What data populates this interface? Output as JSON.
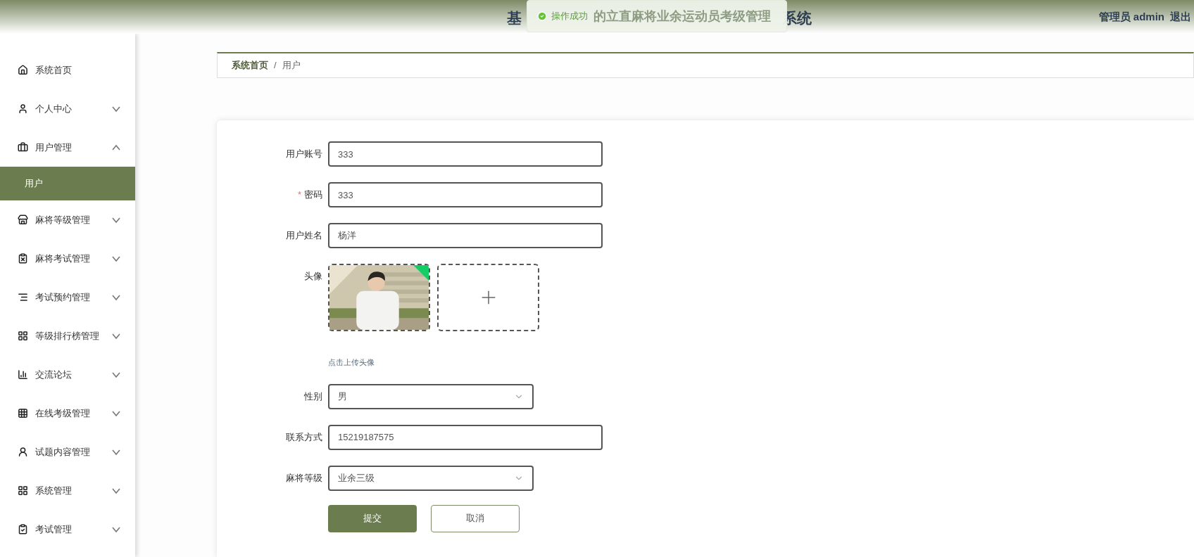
{
  "header": {
    "title_start": "基",
    "title_hidden": "的立直麻将业余运动员考级管理",
    "title_end": "系统",
    "user_label": "管理员 admin",
    "logout": "退出"
  },
  "toast": {
    "message": "操作成功"
  },
  "sidebar": {
    "items": [
      {
        "label": "系统首页",
        "has_submenu": false
      },
      {
        "label": "个人中心",
        "has_submenu": true,
        "expanded": false
      },
      {
        "label": "用户管理",
        "has_submenu": true,
        "expanded": true,
        "children": [
          {
            "label": "用户",
            "selected": true
          }
        ]
      },
      {
        "label": "麻将等级管理",
        "has_submenu": true,
        "expanded": false
      },
      {
        "label": "麻将考试管理",
        "has_submenu": true,
        "expanded": false
      },
      {
        "label": "考试预约管理",
        "has_submenu": true,
        "expanded": false
      },
      {
        "label": "等级排行榜管理",
        "has_submenu": true,
        "expanded": false
      },
      {
        "label": "交流论坛",
        "has_submenu": true,
        "expanded": false
      },
      {
        "label": "在线考级管理",
        "has_submenu": true,
        "expanded": false
      },
      {
        "label": "试题内容管理",
        "has_submenu": true,
        "expanded": false
      },
      {
        "label": "系统管理",
        "has_submenu": true,
        "expanded": false
      },
      {
        "label": "考试管理",
        "has_submenu": true,
        "expanded": false
      }
    ]
  },
  "breadcrumb": {
    "separator": "/",
    "items": [
      {
        "label": "系统首页",
        "selected": false
      },
      {
        "label": "用户",
        "selected": true
      }
    ]
  },
  "form": {
    "fields": [
      {
        "kind": "text",
        "label": "用户账号",
        "value": "333"
      },
      {
        "kind": "text",
        "label": "密码",
        "required_mark": "*",
        "value": "333"
      },
      {
        "kind": "text",
        "label": "用户姓名",
        "value": "杨洋"
      },
      {
        "kind": "upload",
        "label": "头像",
        "images": [
          {
            "kind": "picture",
            "uploaded": true
          }
        ],
        "hint": "点击上传头像"
      },
      {
        "kind": "select",
        "label": "性别",
        "value": "男"
      },
      {
        "kind": "text",
        "label": "联系方式",
        "value": "15219187575"
      },
      {
        "kind": "select",
        "label": "麻将等级",
        "value": "业余三级"
      }
    ],
    "buttons": [
      {
        "kind": "primary",
        "label": "提交"
      },
      {
        "kind": "secondary",
        "label": "取消"
      }
    ]
  }
}
